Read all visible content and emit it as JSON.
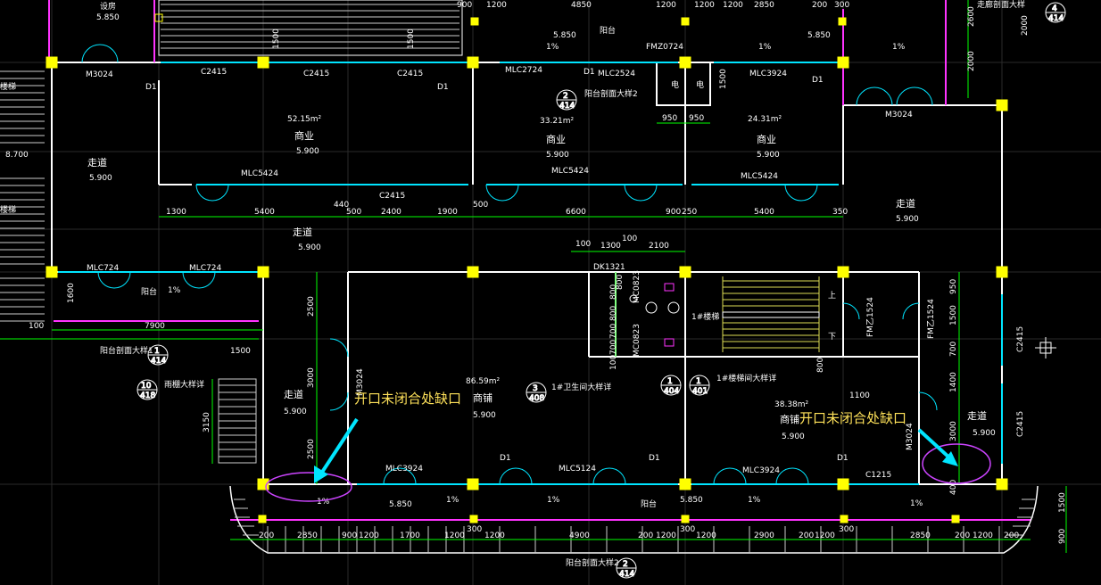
{
  "colors": {
    "background": "#000000",
    "wall": "#ffffff",
    "window": "#00e5ff",
    "dimension": "#00ff00",
    "column": "#ffff00",
    "railing": "#ff33ff",
    "annotation": "#ffe25a",
    "arrow": "#00e5ff"
  },
  "rooms": [
    {
      "name": "商业",
      "area": "52.15m²",
      "elev": "5.900"
    },
    {
      "name": "商业",
      "area": "33.21m²",
      "elev": "5.900"
    },
    {
      "name": "商业",
      "area": "24.31m²",
      "elev": "5.900"
    },
    {
      "name": "商铺",
      "area": "86.59m²",
      "elev": "5.900"
    },
    {
      "name": "商铺",
      "area": "38.38m²",
      "elev": "5.900"
    }
  ],
  "corridors": [
    {
      "name": "走道",
      "elev": "5.900"
    },
    {
      "name": "走道",
      "elev": "5.900"
    },
    {
      "name": "走道",
      "elev": "5.900"
    },
    {
      "name": "走道",
      "elev": "5.900"
    },
    {
      "name": "走道",
      "elev": "5.900"
    }
  ],
  "openings": [
    "M3024",
    "C2415",
    "C2415",
    "C2415",
    "MLC2724",
    "D1",
    "MLC2524",
    "FMZ0724",
    "MLC3924",
    "D1",
    "M3024",
    "MLC5424",
    "C2415",
    "MLC5424",
    "MLC5424",
    "MLC724",
    "MLC724",
    "D1",
    "D1",
    "MLC3924",
    "MLC5124",
    "MLC3924",
    "C1215",
    "FM乙1524",
    "FM乙1524",
    "C2415",
    "C2415",
    "DK1321",
    "M3024",
    "M3024",
    "D1",
    "D1",
    "D1"
  ],
  "dims": {
    "mid_row": [
      "1300",
      "5400",
      "440",
      "500",
      "2400",
      "1900",
      "500",
      "6600",
      "900",
      "250",
      "5400",
      "350"
    ],
    "bottom_row": [
      "200",
      "2850",
      "900",
      "1200",
      "1700",
      "1200",
      "300",
      "1200",
      "4900",
      "200",
      "1200",
      "300",
      "1200",
      "2900",
      "200",
      "1200",
      "300",
      "2850",
      "200",
      "1200",
      "200"
    ],
    "top_row": [
      "900",
      "1200",
      "4850",
      "1200",
      "1200",
      "1200",
      "2850",
      "200",
      "300"
    ],
    "stair_row": [
      "100",
      "1300",
      "100",
      "2100"
    ],
    "misc": [
      "950",
      "950",
      "1500",
      "1500",
      "1500",
      "2600",
      "2000",
      "2500",
      "3000",
      "2500",
      "3150",
      "1500",
      "7900",
      "1600",
      "100",
      "100",
      "800",
      "800",
      "700",
      "700",
      "800",
      "1100",
      "800",
      "950",
      "1500",
      "700",
      "1400",
      "3000",
      "400",
      "1500",
      "900",
      "2000"
    ]
  },
  "labels": {
    "top_left_room": "设房",
    "top_left_elev": "5.850",
    "balcony": "阳台",
    "balcony_detail_2": "阳台剖面大样2",
    "balcony_detail_1": "阳台剖面大样1",
    "balcony_detail_2b": "阳台剖面大样2",
    "corridor_detail": "走廊剖面大样",
    "canopy_detail": "雨棚大样详",
    "toilet_detail": "1#卫生间大样详",
    "stair_detail": "1#楼梯间大样详",
    "stair": "1#楼梯",
    "stair_up": "上",
    "stair_down": "下",
    "elevator": "电",
    "elevator2": "电",
    "slope_1pct": "1%",
    "elev_5850": "5.850",
    "left_elev": "8.700",
    "left_stair_a": "楼梯",
    "left_stair_b": "楼梯",
    "mc_a": "MC0823",
    "mc_b": "MC0823"
  },
  "bubbles": [
    {
      "top": "2",
      "bottom": "414"
    },
    {
      "top": "1",
      "bottom": "414"
    },
    {
      "top": "10",
      "bottom": "418"
    },
    {
      "top": "3",
      "bottom": "408"
    },
    {
      "top": "1",
      "bottom": "404"
    },
    {
      "top": "1",
      "bottom": "401"
    },
    {
      "top": "2",
      "bottom": "414"
    },
    {
      "top": "4",
      "bottom": "414"
    }
  ],
  "notes": [
    {
      "text": "开口未闭合处缺口"
    },
    {
      "text": "开口未闭合处缺口"
    }
  ]
}
